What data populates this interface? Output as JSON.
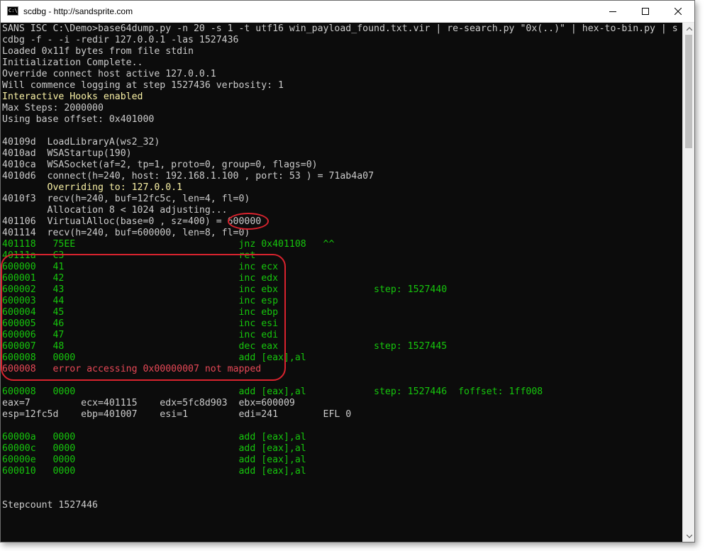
{
  "window": {
    "title": "scdbg - http://sandsprite.com",
    "icon_label": "C:\\"
  },
  "console": {
    "lines": [
      {
        "text": "SANS ISC C:\\Demo>base64dump.py -n 20 -s 1 -t utf16 win_payload_found.txt.vir | re-search.py \"0x(..)\" | hex-to-bin.py | s",
        "color": "w"
      },
      {
        "text": "cdbg -f - -i -redir 127.0.0.1 -las 1527436",
        "color": "w"
      },
      {
        "text": "Loaded 0x11f bytes from file stdin",
        "color": "w"
      },
      {
        "text": "Initialization Complete..",
        "color": "w"
      },
      {
        "text": "Override connect host active 127.0.0.1",
        "color": "w"
      },
      {
        "text": "Will commence logging at step 1527436 verbosity: 1",
        "color": "w"
      },
      {
        "text": "Interactive Hooks enabled",
        "color": "y"
      },
      {
        "text": "Max Steps: 2000000",
        "color": "w"
      },
      {
        "text": "Using base offset: 0x401000",
        "color": "w"
      },
      {
        "text": "",
        "color": "w"
      },
      {
        "text": "40109d  LoadLibraryA(ws2_32)",
        "color": "w"
      },
      {
        "text": "4010ad  WSAStartup(190)",
        "color": "w"
      },
      {
        "text": "4010ca  WSASocket(af=2, tp=1, proto=0, group=0, flags=0)",
        "color": "w"
      },
      {
        "text": "4010d6  connect(h=240, host: 192.168.1.100 , port: 53 ) = 71ab4a07",
        "color": "w"
      },
      {
        "text": "        Overriding to: 127.0.0.1",
        "color": "y"
      },
      {
        "text": "4010f3  recv(h=240, buf=12fc5c, len=4, fl=0)",
        "color": "w"
      },
      {
        "text": "        Allocation 8 < 1024 adjusting...",
        "color": "w"
      },
      {
        "text": "401106  VirtualAlloc(base=0 , sz=400) = 600000",
        "color": "w"
      },
      {
        "text": "401114  recv(h=240, buf=600000, len=8, fl=0)",
        "color": "w"
      },
      {
        "text": "401118   75EE                             jnz 0x401108   ^^",
        "color": "g"
      },
      {
        "text": "40111a   C3                               ret",
        "color": "g"
      },
      {
        "text": "600000   41                               inc ecx",
        "color": "g"
      },
      {
        "text": "600001   42                               inc edx",
        "color": "g"
      },
      {
        "text": "600002   43                               inc ebx                 step: 1527440",
        "color": "g"
      },
      {
        "text": "600003   44                               inc esp",
        "color": "g"
      },
      {
        "text": "600004   45                               inc ebp",
        "color": "g"
      },
      {
        "text": "600005   46                               inc esi",
        "color": "g"
      },
      {
        "text": "600006   47                               inc edi",
        "color": "g"
      },
      {
        "text": "600007   48                               dec eax                 step: 1527445",
        "color": "g"
      },
      {
        "text": "600008   0000                             add [eax],al",
        "color": "g"
      },
      {
        "text": "600008   error accessing 0x00000007 not mapped",
        "color": "r"
      },
      {
        "text": "",
        "color": "w"
      },
      {
        "text": "600008   0000                             add [eax],al            step: 1527446  foffset: 1ff008",
        "color": "g"
      },
      {
        "text": "eax=7         ecx=401115    edx=5fc8d903  ebx=600009",
        "color": "w"
      },
      {
        "text": "esp=12fc5d    ebp=401007    esi=1         edi=241        EFL 0",
        "color": "w"
      },
      {
        "text": "",
        "color": "w"
      },
      {
        "text": "60000a   0000                             add [eax],al",
        "color": "g"
      },
      {
        "text": "60000c   0000                             add [eax],al",
        "color": "g"
      },
      {
        "text": "60000e   0000                             add [eax],al",
        "color": "g"
      },
      {
        "text": "600010   0000                             add [eax],al",
        "color": "g"
      },
      {
        "text": "",
        "color": "w"
      },
      {
        "text": "",
        "color": "w"
      },
      {
        "text": "Stepcount 1527446",
        "color": "w"
      }
    ]
  },
  "annotations": {
    "highlighted_value": "600000",
    "highlight_color": "#d9232e"
  },
  "colors": {
    "console_bg": "#0c0c0c",
    "default_text": "#cccccc",
    "green": "#16c60c",
    "yellow": "#f9f1a5",
    "red": "#e74856"
  }
}
